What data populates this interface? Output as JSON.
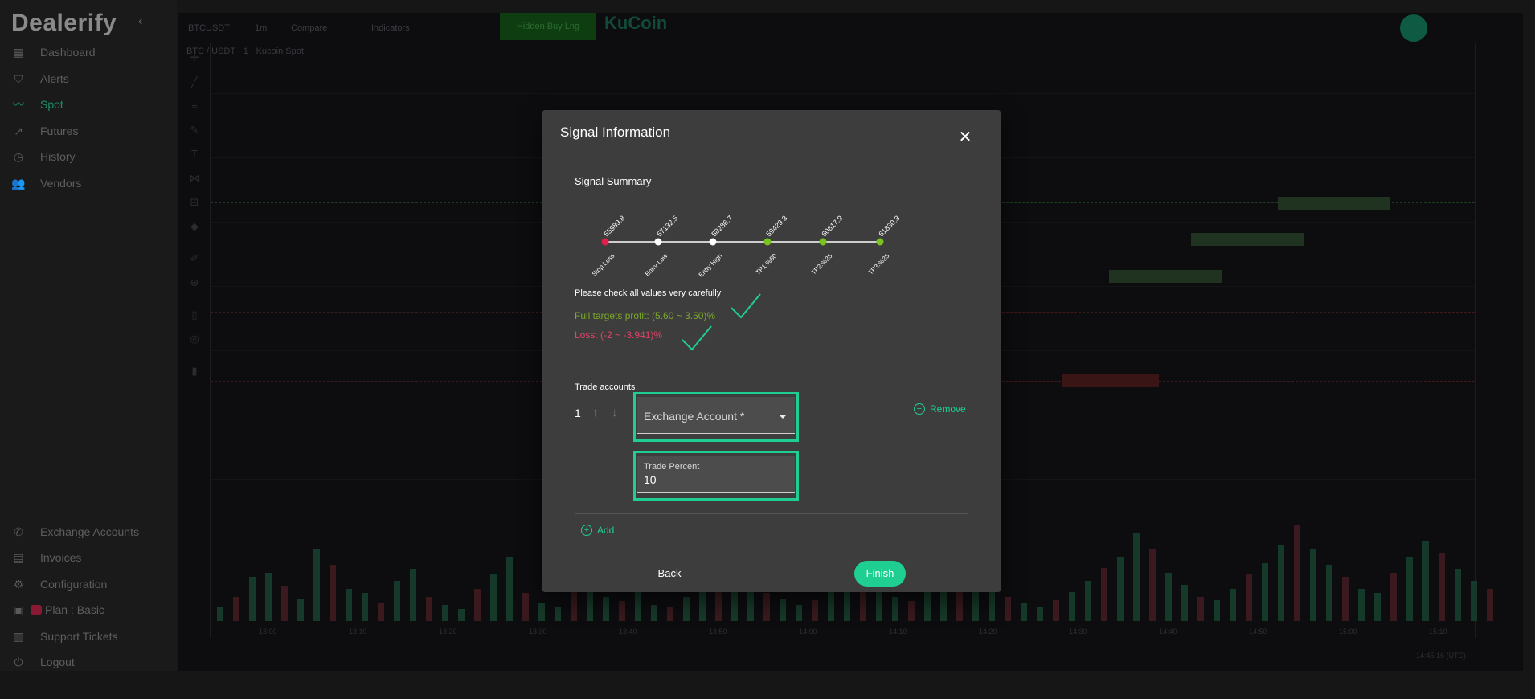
{
  "app": {
    "logo": "Dealerify"
  },
  "sidebar": {
    "items": [
      {
        "label": "Dashboard",
        "icon": "dashboard-icon"
      },
      {
        "label": "Alerts",
        "icon": "shield-icon"
      },
      {
        "label": "Spot",
        "icon": "trend-icon",
        "active": true
      },
      {
        "label": "Futures",
        "icon": "trend-up-icon"
      },
      {
        "label": "History",
        "icon": "history-icon"
      },
      {
        "label": "Vendors",
        "icon": "users-icon"
      }
    ],
    "bottom_items": [
      {
        "label": "Exchange Accounts",
        "icon": "phone-icon"
      },
      {
        "label": "Invoices",
        "icon": "document-icon"
      },
      {
        "label": "Configuration",
        "icon": "gear-icon"
      },
      {
        "label": "Plan : Basic",
        "icon": "plan-icon"
      },
      {
        "label": "Support Tickets",
        "icon": "ticket-icon"
      },
      {
        "label": "Logout",
        "icon": "power-icon"
      }
    ]
  },
  "chart_bg": {
    "symbol_short": "BTCUSDT",
    "interval": "1m",
    "compare": "Compare",
    "indicators": "Indicators",
    "green_button": "Hidden Buy Lng",
    "exchange": "KuCoin",
    "symbol_line": "BTC / USDT · 1 · Kucoin Spot",
    "time_labels": [
      "13:00",
      "13:10",
      "13:20",
      "13:30",
      "13:40",
      "13:50",
      "14:00",
      "14:10",
      "14:20",
      "14:30",
      "14:40",
      "14:50",
      "15:00",
      "15:10"
    ],
    "timestamp": "14:45:16 (UTC)"
  },
  "modal": {
    "title": "Signal Information",
    "summary_title": "Signal Summary",
    "points": [
      {
        "value": "55989.8",
        "label": "Stop Loss",
        "color": "#e0204a"
      },
      {
        "value": "57132.5",
        "label": "Entry Low",
        "color": "#ffffff"
      },
      {
        "value": "58286.7",
        "label": "Entry High",
        "color": "#ffffff"
      },
      {
        "value": "59429.3",
        "label": "TP1:%50",
        "color": "#7ac41f"
      },
      {
        "value": "60617.9",
        "label": "TP2:%25",
        "color": "#7ac41f"
      },
      {
        "value": "61830.3",
        "label": "TP3:%25",
        "color": "#7ac41f"
      }
    ],
    "check_note": "Please check all values very carefully",
    "profit_text": "Full targets profit: (5.60 ~ 3.50)%",
    "loss_text": "Loss: (-2 ~ -3.941)%",
    "trade_accounts_title": "Trade accounts",
    "account_index": "1",
    "exchange_account_label": "Exchange Account *",
    "trade_percent_label": "Trade Percent",
    "trade_percent_value": "10",
    "remove_label": "Remove",
    "add_label": "Add",
    "back_label": "Back",
    "finish_label": "Finish"
  },
  "colors": {
    "accent": "#1fcf92",
    "profit": "#7aa82a",
    "loss": "#e04468",
    "modal_bg": "#3d3d3d"
  }
}
